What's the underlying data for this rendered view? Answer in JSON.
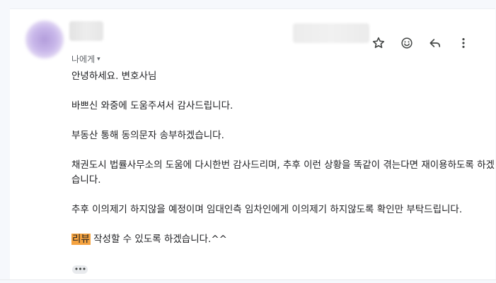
{
  "header": {
    "recipient_label": "나에게",
    "recipient_caret": "▾"
  },
  "actions": {
    "star_icon": "star-icon",
    "emoji_icon": "add-reaction-icon",
    "reply_icon": "reply-icon",
    "more_icon": "more-vert-icon"
  },
  "message": {
    "greeting": "안녕하세요. 변호사님",
    "line1": "바쁘신 와중에 도움주셔서 감사드립니다.",
    "line2": "부동산 통해 동의문자 송부하겠습니다.",
    "line3": "채권도시 법률사무소의 도움에 다시한번 감사드리며, 추후 이런 상황을 똑같이 겪는다면 재이용하도록 하겠습니다.",
    "line4": "추후 이의제기 하지않을 예정이며 임대인측 임차인에게 이의제기 하지않도록 확인만 부탁드립니다.",
    "line5_highlight": "리뷰",
    "line5_rest": " 작성할 수 있도록 하겠습니다.^^",
    "highlight_color": "#f5a340"
  },
  "trimmed_content_label": "•••"
}
